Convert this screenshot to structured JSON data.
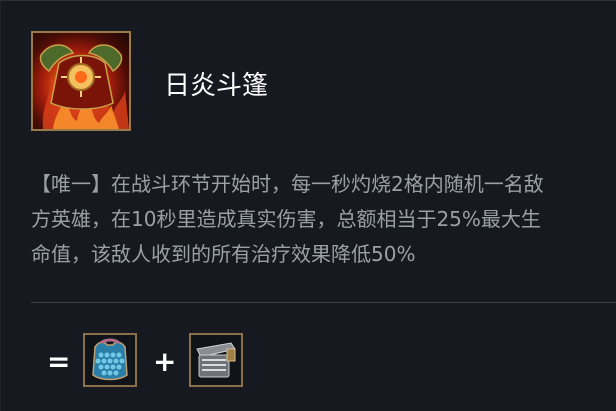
{
  "item": {
    "name": "日炎斗篷",
    "icon": "sunfire-cape-icon",
    "description_lines": [
      "【唯一】在战斗环节开始时，每一秒灼烧2格内随机一名敌",
      "方英雄，在10秒里造成真实伤害，总额相当于25%最大生",
      "命值，该敌人收到的所有治疗效果降低50%"
    ]
  },
  "recipe": {
    "equals": "=",
    "plus": "+",
    "components": [
      {
        "icon": "chain-vest-icon"
      },
      {
        "icon": "giants-belt-icon"
      }
    ]
  }
}
